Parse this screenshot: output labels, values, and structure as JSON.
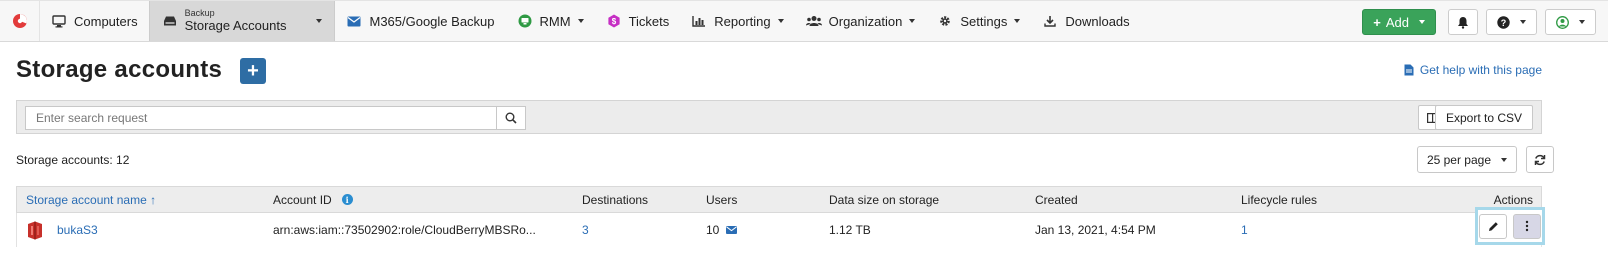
{
  "colors": {
    "brand": "#e23b3b",
    "link": "#2a6db5",
    "add": "#3aa35a",
    "primary": "#2e6da4",
    "highlight": "#a6d8ea"
  },
  "nav": {
    "items": [
      {
        "label": "Computers",
        "icon": "monitor-icon"
      },
      {
        "small": "Backup",
        "label": "Storage Accounts",
        "icon": "storage-icon",
        "active": true
      },
      {
        "label": "M365/Google Backup",
        "icon": "envelope-icon"
      },
      {
        "label": "RMM",
        "icon": "rmm-icon"
      },
      {
        "label": "Tickets",
        "icon": "tickets-icon"
      },
      {
        "label": "Reporting",
        "icon": "chart-icon"
      },
      {
        "label": "Organization",
        "icon": "users-icon"
      },
      {
        "label": "Settings",
        "icon": "gear-icon"
      },
      {
        "label": "Downloads",
        "icon": "download-icon"
      }
    ],
    "add_label": "Add"
  },
  "page": {
    "title": "Storage accounts",
    "help_link": "Get help with this page"
  },
  "search": {
    "placeholder": "Enter search request",
    "export_label": "Export to CSV"
  },
  "summary": {
    "count_text": "Storage accounts: 12",
    "per_page": "25 per page"
  },
  "table": {
    "headers": {
      "name": "Storage account name ↑",
      "account_id": "Account ID",
      "destinations": "Destinations",
      "users": "Users",
      "data_size": "Data size on storage",
      "created": "Created",
      "lifecycle": "Lifecycle rules",
      "actions": "Actions"
    },
    "rows": [
      {
        "name": "bukaS3",
        "account_id": "arn:aws:iam::73502902:role/CloudBerryMBSRo...",
        "destinations": "3",
        "users": "10",
        "data_size": "1.12 TB",
        "created": "Jan 13, 2021, 4:54 PM",
        "lifecycle": "1"
      }
    ]
  }
}
